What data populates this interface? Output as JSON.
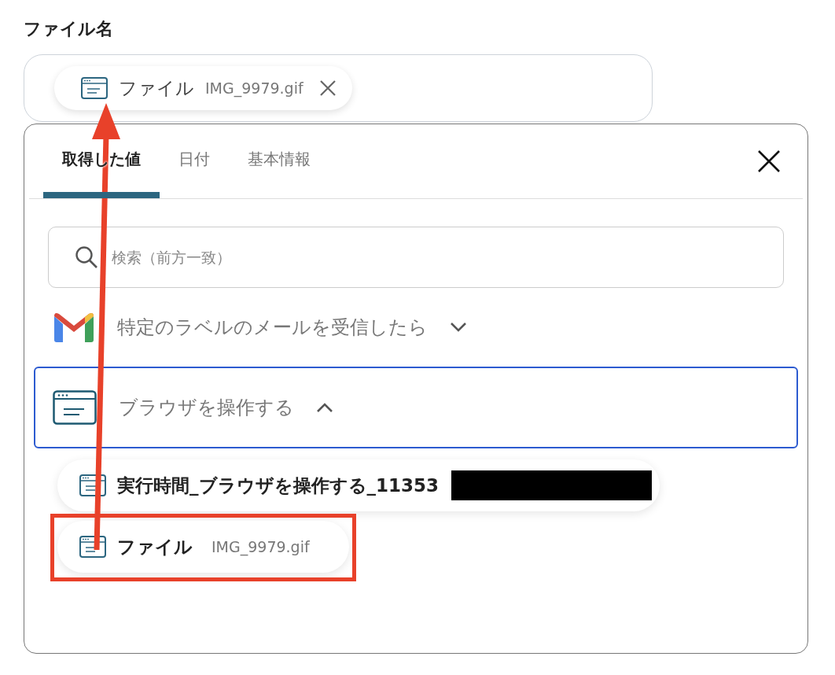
{
  "field": {
    "label": "ファイル名",
    "chip": {
      "name": "ファイル",
      "value": "IMG_9979.gif"
    }
  },
  "popup": {
    "tabs": [
      {
        "label": "取得した値",
        "selected": true
      },
      {
        "label": "日付",
        "selected": false
      },
      {
        "label": "基本情報",
        "selected": false
      }
    ],
    "search": {
      "placeholder": "検索（前方一致）"
    },
    "groups": [
      {
        "kind": "gmail",
        "title": "特定のラベルのメールを受信したら",
        "expanded": false,
        "selected": false
      },
      {
        "kind": "browser",
        "title": "ブラウザを操作する",
        "expanded": true,
        "selected": true,
        "items": [
          {
            "name": "実行時間_ブラウザを操作する_11353",
            "redacted": true,
            "highlighted": false
          },
          {
            "name": "ファイル",
            "value": "IMG_9979.gif",
            "redacted": false,
            "highlighted": true
          }
        ]
      }
    ]
  }
}
